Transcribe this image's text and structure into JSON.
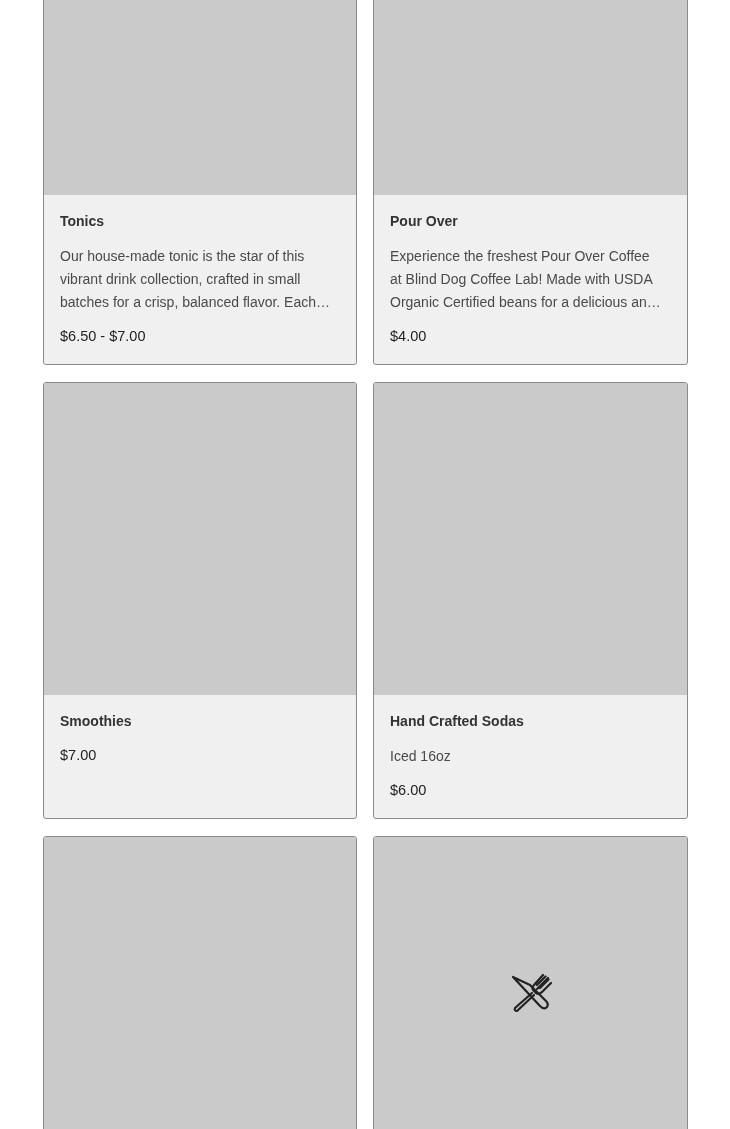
{
  "cards": [
    {
      "image": {
        "kind": "blank"
      },
      "title": "Tonics",
      "description": "Our house-made tonic is the star of this vibrant drink collection, crafted in small batches for a crisp, balanced flavor. Each…",
      "price": "$6.50 - $7.00"
    },
    {
      "image": {
        "kind": "blank"
      },
      "title": "Pour Over",
      "description": "Experience the freshest Pour Over Coffee at Blind Dog Coffee Lab! Made with USDA Organic Certified beans for a delicious an…",
      "price": "$4.00"
    },
    {
      "image": {
        "kind": "blank"
      },
      "title": "Smoothies",
      "price": "$7.00"
    },
    {
      "image": {
        "kind": "blank"
      },
      "title": "Hand Crafted Sodas",
      "description": "Iced 16oz",
      "price": "$6.00"
    },
    {
      "image": {
        "kind": "blank"
      }
    },
    {
      "image": {
        "kind": "utensils"
      }
    }
  ]
}
